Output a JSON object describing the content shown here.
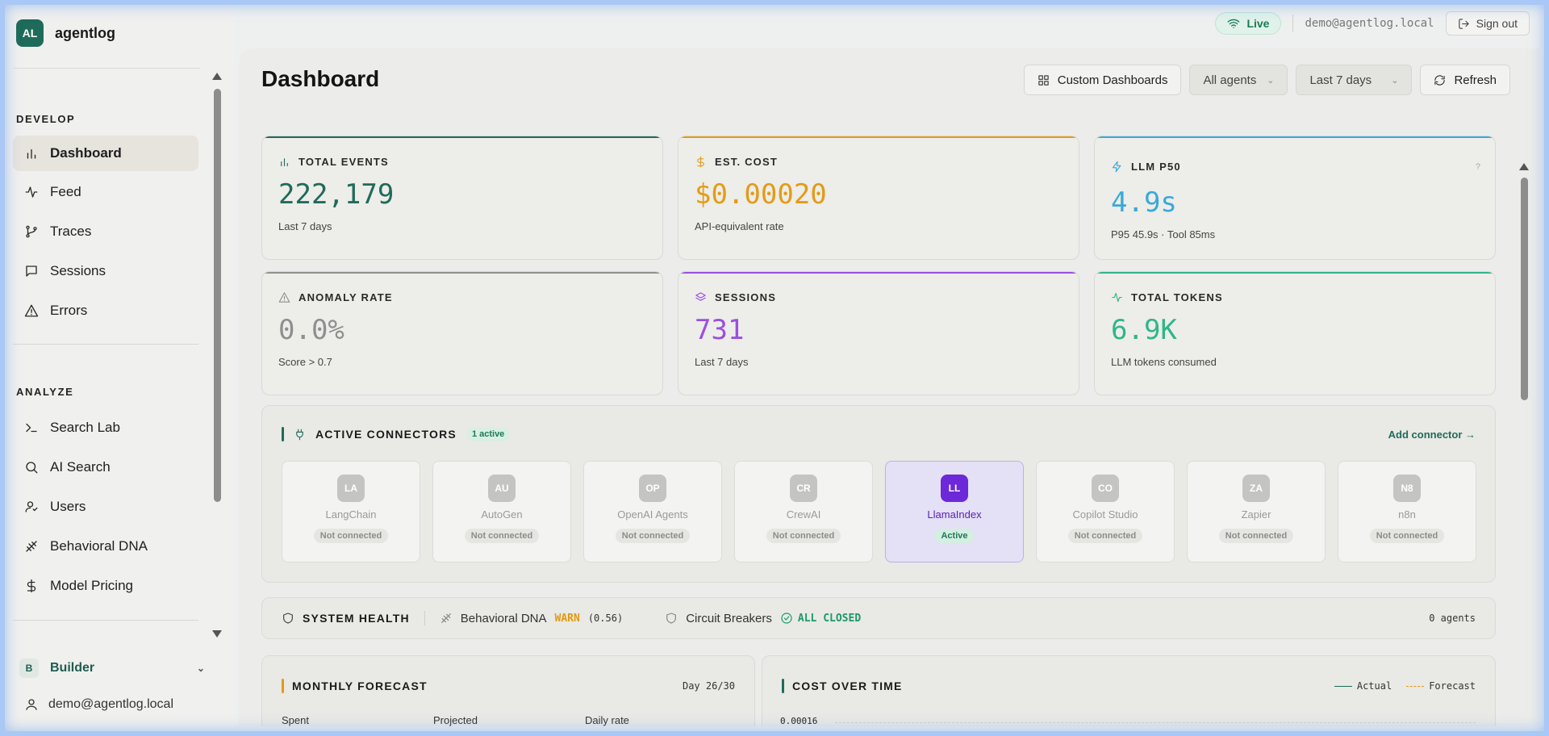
{
  "brand": {
    "logo": "AL",
    "name": "agentlog"
  },
  "topbar": {
    "live_label": "Live",
    "email": "demo@agentlog.local",
    "signout_label": "Sign out"
  },
  "sidebar": {
    "develop_title": "DEVELOP",
    "develop_items": [
      {
        "label": "Dashboard",
        "icon": "bar-chart-icon",
        "active": true
      },
      {
        "label": "Feed",
        "icon": "activity-icon"
      },
      {
        "label": "Traces",
        "icon": "git-branch-icon"
      },
      {
        "label": "Sessions",
        "icon": "message-square-icon"
      },
      {
        "label": "Errors",
        "icon": "alert-triangle-icon"
      }
    ],
    "analyze_title": "ANALYZE",
    "analyze_items": [
      {
        "label": "Search Lab",
        "icon": "terminal-icon"
      },
      {
        "label": "AI Search",
        "icon": "search-icon"
      },
      {
        "label": "Users",
        "icon": "user-icon"
      },
      {
        "label": "Behavioral DNA",
        "icon": "dna-icon"
      },
      {
        "label": "Model Pricing",
        "icon": "dollar-icon"
      }
    ],
    "workspace": {
      "badge": "B",
      "label": "Builder"
    },
    "user_email": "demo@agentlog.local"
  },
  "page": {
    "title": "Dashboard",
    "custom_dashboards_label": "Custom Dashboards",
    "agent_filter": "All agents",
    "range_filter": "Last 7 days",
    "refresh_label": "Refresh"
  },
  "stats": [
    {
      "label": "TOTAL EVENTS",
      "value": "222,179",
      "sub": "Last 7 days",
      "accent": "#1f6b5a",
      "icon": "bar-chart-icon"
    },
    {
      "label": "EST. COST",
      "value": "$0.00020",
      "sub": "API-equivalent rate",
      "accent": "#e39b16",
      "icon": "dollar-icon"
    },
    {
      "label": "LLM P50",
      "value": "4.9s",
      "sub": "P95 45.9s · Tool 85ms",
      "accent": "#3aa9d8",
      "icon": "zap-icon",
      "help": "?"
    },
    {
      "label": "ANOMALY RATE",
      "value": "0.0%",
      "sub": "Score > 0.7",
      "accent": "#8f8f8f",
      "icon": "alert-triangle-icon"
    },
    {
      "label": "SESSIONS",
      "value": "731",
      "sub": "Last 7 days",
      "accent": "#9b4fe0",
      "icon": "layers-icon"
    },
    {
      "label": "TOTAL TOKENS",
      "value": "6.9K",
      "sub": "LLM tokens consumed",
      "accent": "#2fb68a",
      "icon": "activity-icon"
    }
  ],
  "connectors": {
    "title": "ACTIVE CONNECTORS",
    "count_badge": "1 active",
    "add_label": "Add connector →",
    "items": [
      {
        "abbr": "LA",
        "name": "LangChain",
        "status": "Not connected",
        "active": false
      },
      {
        "abbr": "AU",
        "name": "AutoGen",
        "status": "Not connected",
        "active": false
      },
      {
        "abbr": "OP",
        "name": "OpenAI Agents",
        "status": "Not connected",
        "active": false
      },
      {
        "abbr": "CR",
        "name": "CrewAI",
        "status": "Not connected",
        "active": false
      },
      {
        "abbr": "LL",
        "name": "LlamaIndex",
        "status": "Active",
        "active": true
      },
      {
        "abbr": "CO",
        "name": "Copilot Studio",
        "status": "Not connected",
        "active": false
      },
      {
        "abbr": "ZA",
        "name": "Zapier",
        "status": "Not connected",
        "active": false
      },
      {
        "abbr": "N8",
        "name": "n8n",
        "status": "Not connected",
        "active": false
      }
    ]
  },
  "health": {
    "title": "SYSTEM HEALTH",
    "dna_label": "Behavioral DNA",
    "dna_status": "WARN",
    "dna_score": "(0.56)",
    "cb_label": "Circuit Breakers",
    "cb_status": "ALL CLOSED",
    "agents": "0 agents"
  },
  "forecast": {
    "title": "MONTHLY FORECAST",
    "day": "Day 26/30",
    "cols": [
      "Spent",
      "Projected",
      "Daily rate"
    ]
  },
  "cost": {
    "title": "COST OVER TIME",
    "legend_actual": "Actual",
    "legend_forecast": "Forecast",
    "ytick": "0.00016"
  }
}
